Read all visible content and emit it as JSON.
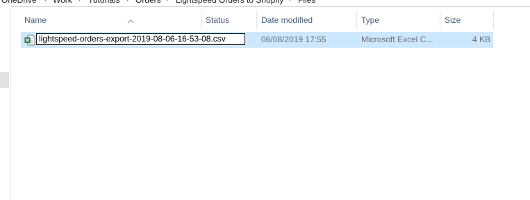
{
  "breadcrumb": {
    "items": [
      "OneDrive",
      "Work",
      "Tutorials",
      "Orders",
      "Lightspeed Orders to Shopify",
      "Files"
    ]
  },
  "columns": {
    "name": "Name",
    "status": "Status",
    "date_modified": "Date modified",
    "type": "Type",
    "size": "Size"
  },
  "files": [
    {
      "name": "lightspeed-orders-export-2019-08-06-16-53-08.csv",
      "date_modified": "06/08/2019 17:55",
      "type": "Microsoft Excel C...",
      "size": "4 KB",
      "icon": "excel-csv-icon",
      "state": "selected-renaming"
    }
  ],
  "colors": {
    "selection": "#cce8ff",
    "header_text": "#4c607a",
    "muted_text": "#6d6d6d",
    "excel_green": "#1d7044"
  }
}
